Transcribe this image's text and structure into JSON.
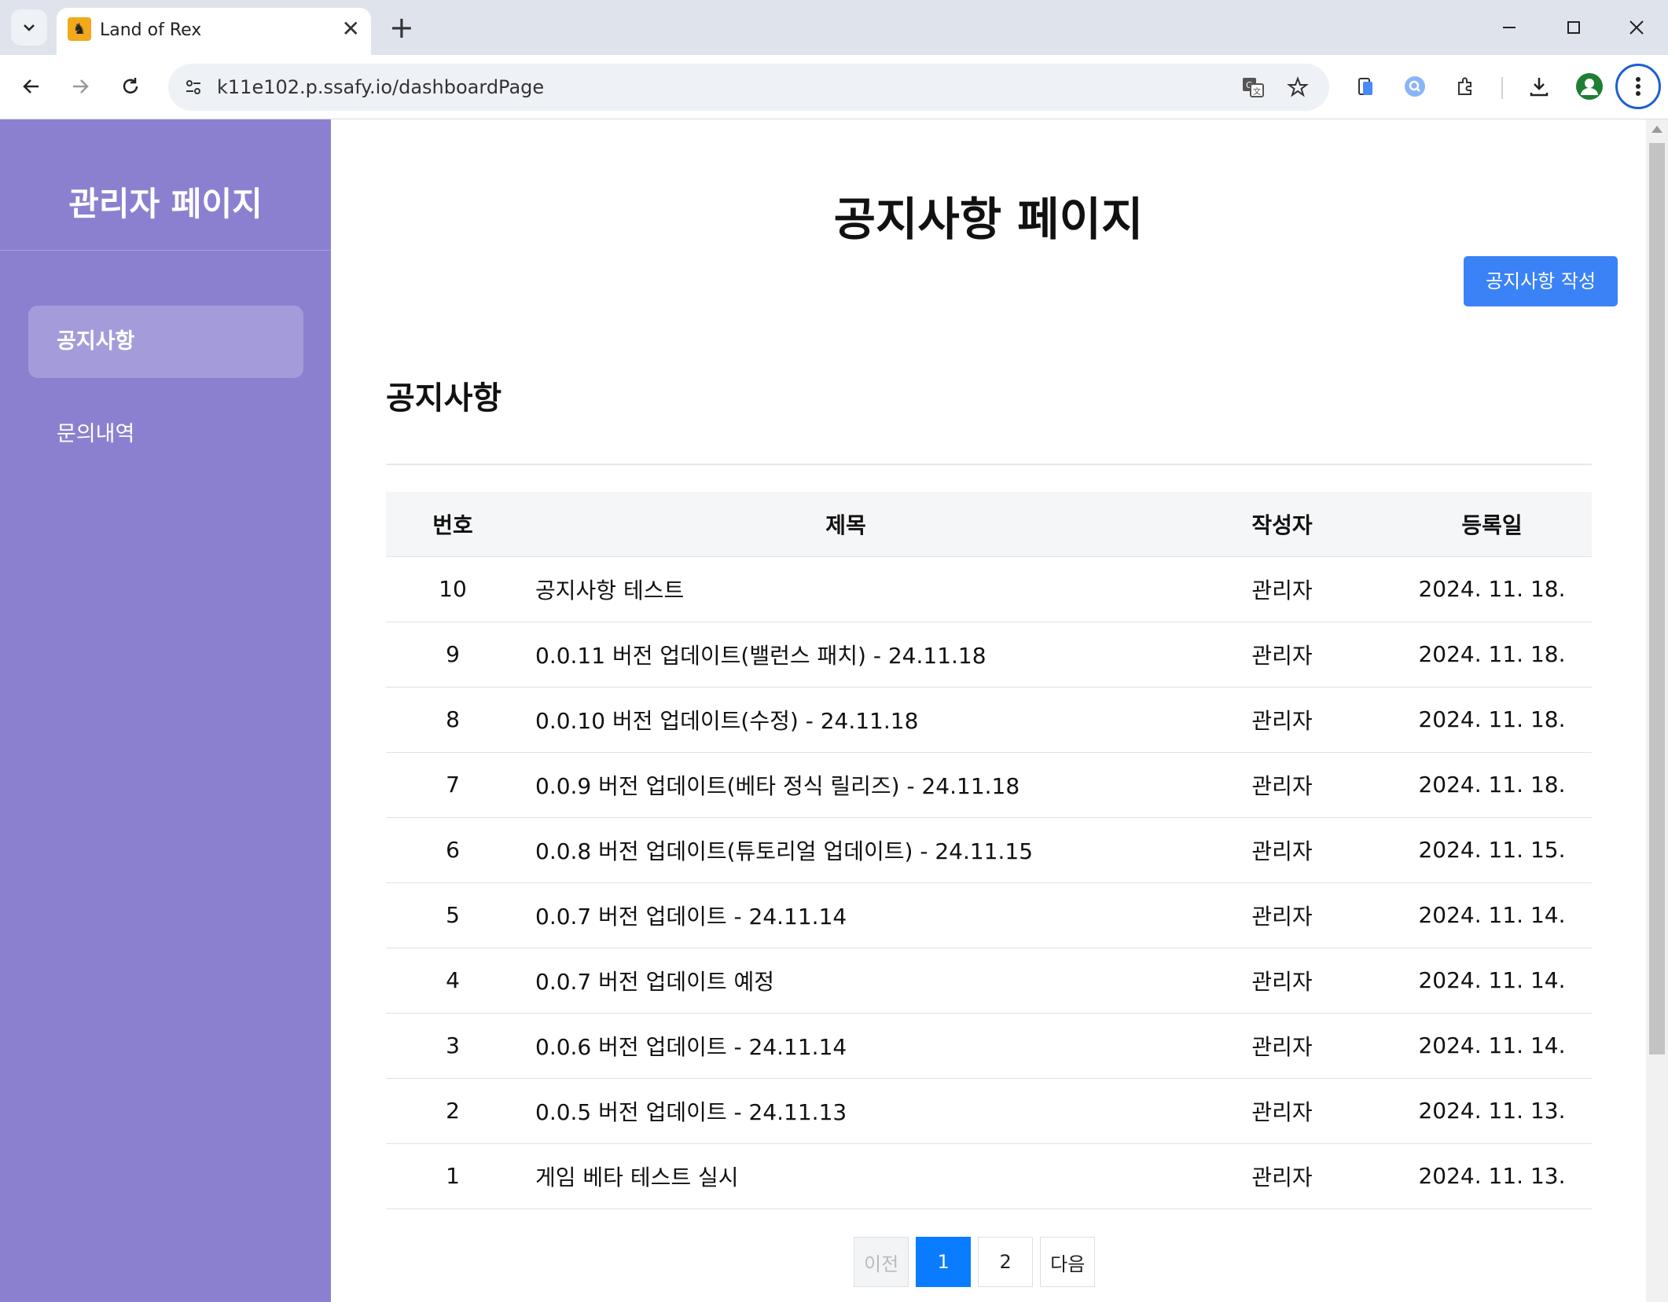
{
  "browser": {
    "tab_title": "Land of Rex",
    "url": "k11e102.p.ssafy.io/dashboardPage",
    "icons": [
      "chevron-down-icon",
      "close-icon",
      "plus-icon",
      "minimize-icon",
      "maximize-icon",
      "close-window-icon",
      "back-icon",
      "forward-icon",
      "reload-icon",
      "site-settings-icon",
      "translate-icon",
      "star-icon",
      "phone-icon",
      "lens-icon",
      "extensions-icon",
      "download-icon",
      "profile-icon",
      "more-vertical-icon"
    ]
  },
  "sidebar": {
    "title": "관리자 페이지",
    "items": [
      {
        "label": "공지사항",
        "active": true
      },
      {
        "label": "문의내역",
        "active": false
      }
    ]
  },
  "main": {
    "page_title": "공지사항 페이지",
    "write_button": "공지사항 작성",
    "section_title": "공지사항",
    "table": {
      "headers": {
        "num": "번호",
        "title": "제목",
        "author": "작성자",
        "date": "등록일"
      },
      "rows": [
        {
          "num": "10",
          "title": "공지사항 테스트",
          "author": "관리자",
          "date": "2024. 11. 18."
        },
        {
          "num": "9",
          "title": "0.0.11 버전 업데이트(밸런스 패치) - 24.11.18",
          "author": "관리자",
          "date": "2024. 11. 18."
        },
        {
          "num": "8",
          "title": "0.0.10 버전 업데이트(수정) - 24.11.18",
          "author": "관리자",
          "date": "2024. 11. 18."
        },
        {
          "num": "7",
          "title": "0.0.9 버전 업데이트(베타 정식 릴리즈) - 24.11.18",
          "author": "관리자",
          "date": "2024. 11. 18."
        },
        {
          "num": "6",
          "title": "0.0.8 버전 업데이트(튜토리얼 업데이트) - 24.11.15",
          "author": "관리자",
          "date": "2024. 11. 15."
        },
        {
          "num": "5",
          "title": "0.0.7 버전 업데이트 - 24.11.14",
          "author": "관리자",
          "date": "2024. 11. 14."
        },
        {
          "num": "4",
          "title": "0.0.7 버전 업데이트 예정",
          "author": "관리자",
          "date": "2024. 11. 14."
        },
        {
          "num": "3",
          "title": "0.0.6 버전 업데이트 - 24.11.14",
          "author": "관리자",
          "date": "2024. 11. 14."
        },
        {
          "num": "2",
          "title": "0.0.5 버전 업데이트 - 24.11.13",
          "author": "관리자",
          "date": "2024. 11. 13."
        },
        {
          "num": "1",
          "title": "게임 베타 테스트 실시",
          "author": "관리자",
          "date": "2024. 11. 13."
        }
      ]
    },
    "pagination": {
      "prev": "이전",
      "pages": [
        "1",
        "2"
      ],
      "current": "1",
      "next": "다음"
    }
  },
  "colors": {
    "sidebar": "#8b80d0",
    "primary_button": "#3b82f6",
    "current_page": "#0a7cff",
    "focus_ring": "#1b5fd6"
  }
}
